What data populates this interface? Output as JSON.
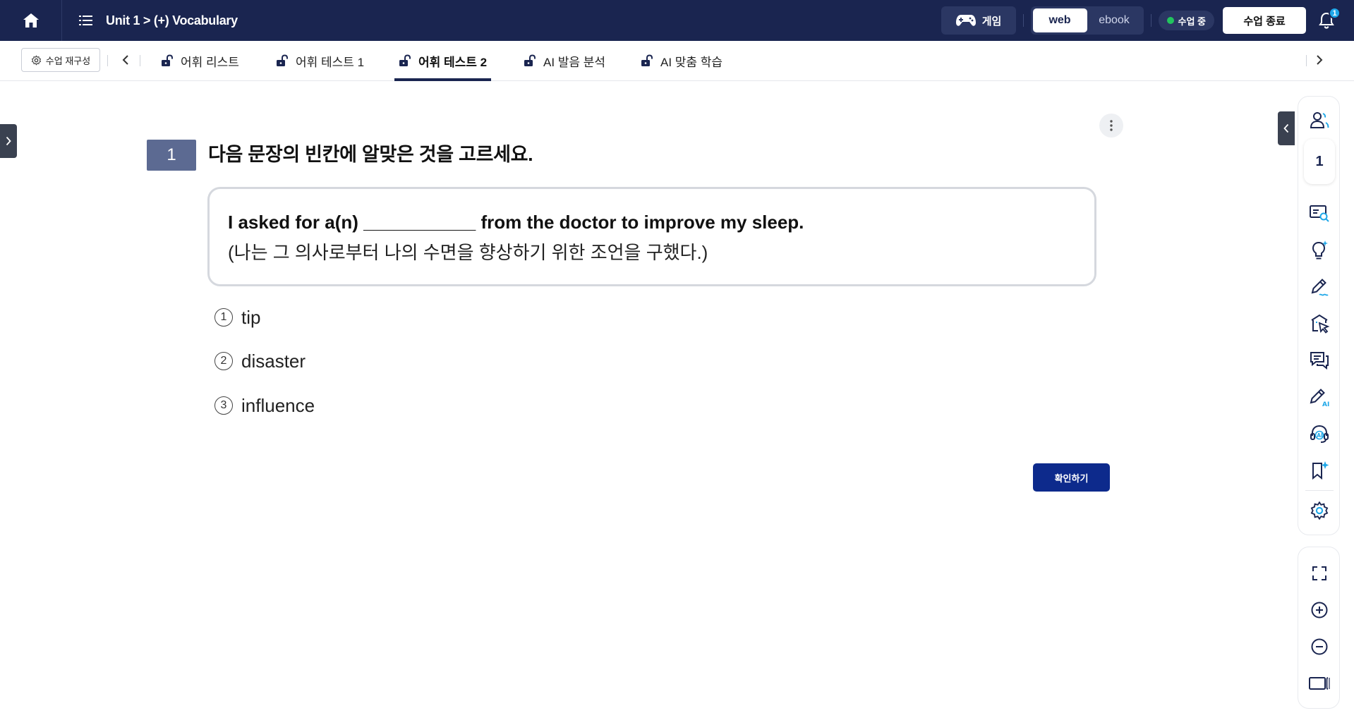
{
  "topbar": {
    "breadcrumb": "Unit 1 > (+) Vocabulary",
    "game_label": "게임",
    "mode_web": "web",
    "mode_ebook": "ebook",
    "live_status": "수업 중",
    "end_label": "수업 종료",
    "notification_count": "1",
    "colors": {
      "bar": "#1a2550",
      "live": "#22c55e",
      "badge": "#1ea7e8"
    }
  },
  "tabbar": {
    "reconfig_label": "수업 재구성",
    "tabs": [
      {
        "label": "어휘 리스트"
      },
      {
        "label": "어휘 테스트 1"
      },
      {
        "label": "어휘 테스트 2"
      },
      {
        "label": "AI 발음 분석"
      },
      {
        "label": "AI 맞춤 학습"
      }
    ],
    "active_tab": "어휘 테스트 2"
  },
  "question": {
    "number": "1",
    "title": "다음 문장의 빈칸에 알맞은 것을 고르세요.",
    "sentence_en": "I asked for a(n) ___________ from the doctor to improve my sleep.",
    "sentence_ko": "(나는 그 의사로부터 나의 수면을 향상하기 위한 조언을 구했다.)",
    "choices": [
      {
        "mark": "1",
        "text": "tip"
      },
      {
        "mark": "2",
        "text": "disaster"
      },
      {
        "mark": "3",
        "text": "influence"
      }
    ],
    "confirm_label": "확인하기",
    "confirm_color": "#0d2a8c"
  },
  "sidebar": {
    "student_count": "1",
    "tools": [
      "students-icon",
      "screen-search-icon",
      "idea-icon",
      "pen-icon",
      "select-icon",
      "chat-icon",
      "ai-pen-icon",
      "ai-headset-icon",
      "bookmark-star-icon",
      "gear-icon"
    ],
    "view_tools": [
      "fullscreen-icon",
      "zoom-in-icon",
      "zoom-out-icon",
      "panel-icon"
    ]
  }
}
